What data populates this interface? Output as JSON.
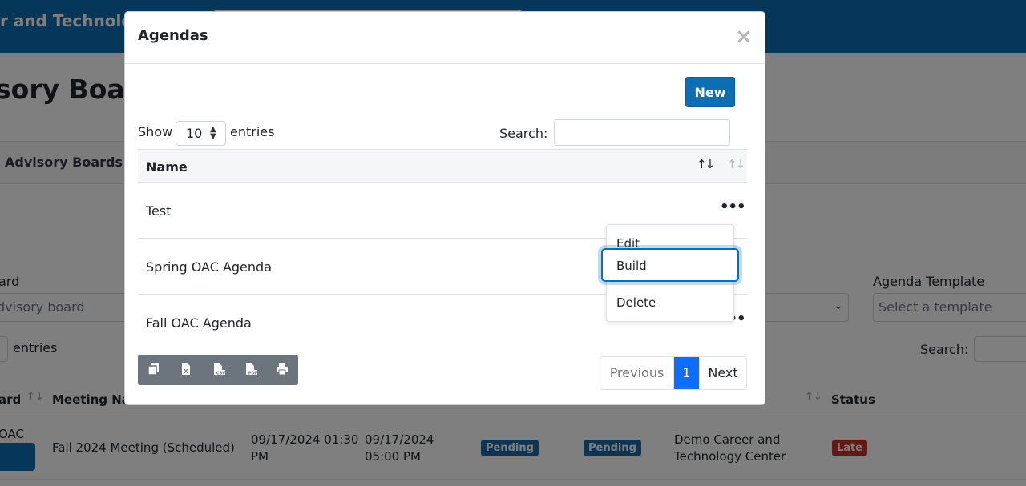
{
  "background": {
    "header_title": "r and Technolog",
    "page_title": "sory Board",
    "tab_label": "Advisory Boards",
    "filters": [
      {
        "label": "ard",
        "placeholder": "dvisory board"
      },
      {
        "label": "Agenda Template",
        "placeholder": "Select a template"
      }
    ],
    "entries_label": "entries",
    "search_label": "Search:",
    "columns": [
      "ard",
      "Meeting Nar",
      "Status"
    ],
    "row": {
      "board": "OAC",
      "meeting": "Fall 2024 Meeting (Scheduled)",
      "start": [
        "09/17/2024 01:30",
        "PM"
      ],
      "end": [
        "09/17/2024",
        "05:00 PM"
      ],
      "status_a": "Pending",
      "status_b": "Pending",
      "center": [
        "Demo Career and",
        "Technology Center"
      ],
      "status": "Late"
    },
    "colors": {
      "header": "#0d6eb4",
      "badge_pending": "#1a6aa6",
      "badge_late": "#c9302c"
    }
  },
  "modal": {
    "title": "Agendas",
    "close_icon": "×",
    "new_label": "New",
    "show_label": "Show",
    "page_length": "10",
    "entries_label": "entries",
    "search_label": "Search:",
    "column_name": "Name",
    "rows": [
      {
        "name": "Test",
        "actions": "•••"
      },
      {
        "name": "Spring OAC Agenda",
        "actions": "•••"
      },
      {
        "name": "Fall OAC Agenda",
        "actions": "•••"
      }
    ],
    "export_buttons": [
      "copy-icon",
      "excel-icon",
      "csv-icon",
      "pdf-icon",
      "print-icon"
    ],
    "pagination": {
      "previous": "Previous",
      "current": "1",
      "next": "Next"
    },
    "actions_menu": {
      "edit": "Edit",
      "build": "Build",
      "delete": "Delete"
    }
  }
}
